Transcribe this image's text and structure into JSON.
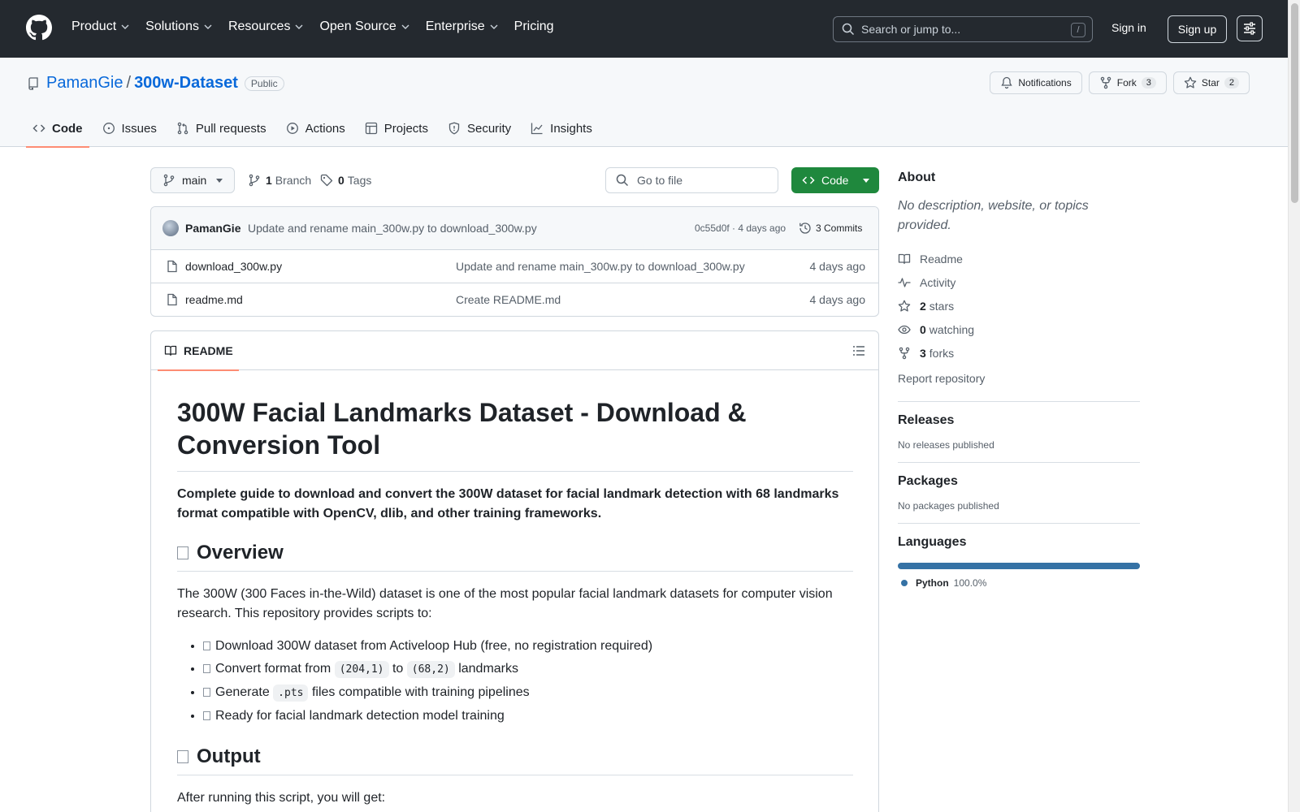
{
  "topbar": {
    "nav": [
      {
        "label": "Product",
        "dropdown": true
      },
      {
        "label": "Solutions",
        "dropdown": true
      },
      {
        "label": "Resources",
        "dropdown": true
      },
      {
        "label": "Open Source",
        "dropdown": true
      },
      {
        "label": "Enterprise",
        "dropdown": true
      },
      {
        "label": "Pricing",
        "dropdown": false
      }
    ],
    "search_placeholder": "Search or jump to...",
    "search_shortcut": "/",
    "signin": "Sign in",
    "signup": "Sign up"
  },
  "repo": {
    "owner": "PamanGie",
    "separator": "/",
    "name": "300w-Dataset",
    "visibility": "Public",
    "notifications_label": "Notifications",
    "fork_label": "Fork",
    "fork_count": "3",
    "star_label": "Star",
    "star_count": "2",
    "tabs": [
      {
        "label": "Code",
        "icon": "code-icon",
        "active": true
      },
      {
        "label": "Issues",
        "icon": "issue-icon",
        "active": false
      },
      {
        "label": "Pull requests",
        "icon": "pull-request-icon",
        "active": false
      },
      {
        "label": "Actions",
        "icon": "play-icon",
        "active": false
      },
      {
        "label": "Projects",
        "icon": "table-icon",
        "active": false
      },
      {
        "label": "Security",
        "icon": "shield-icon",
        "active": false
      },
      {
        "label": "Insights",
        "icon": "graph-icon",
        "active": false
      }
    ]
  },
  "branchbar": {
    "branch": "main",
    "branch_count": "1",
    "branch_label": "Branch",
    "tag_count": "0",
    "tag_label": "Tags",
    "goto_placeholder": "Go to file",
    "code_button": "Code"
  },
  "latest_commit": {
    "author": "PamanGie",
    "message": "Update and rename main_300w.py to download_300w.py",
    "meta": "0c55d0f · 4 days ago",
    "commits": "3 Commits"
  },
  "files": [
    {
      "name": "download_300w.py",
      "commit": "Update and rename main_300w.py to download_300w.py",
      "age": "4 days ago"
    },
    {
      "name": "readme.md",
      "commit": "Create README.md",
      "age": "4 days ago"
    }
  ],
  "readme": {
    "tab_label": "README",
    "title": "300W Facial Landmarks Dataset - Download & Conversion Tool",
    "lead": "Complete guide to download and convert the 300W dataset for facial landmark detection with 68 landmarks format compatible with OpenCV, dlib, and other training frameworks.",
    "overview_heading": "Overview",
    "overview_text": "The 300W (300 Faces in-the-Wild) dataset is one of the most popular facial landmark datasets for computer vision research. This repository provides scripts to:",
    "bullets": {
      "b1": "Download 300W dataset from Activeloop Hub (free, no registration required)",
      "b2_pre": "Convert format from",
      "b2_code1": "(204,1)",
      "b2_mid": "to",
      "b2_code2": "(68,2)",
      "b2_post": "landmarks",
      "b3_pre": "Generate",
      "b3_code": ".pts",
      "b3_post": "files compatible with training pipelines",
      "b4": "Ready for facial landmark detection model training"
    },
    "output_heading": "Output",
    "output_text": "After running this script, you will get:"
  },
  "sidebar": {
    "about_heading": "About",
    "about_desc": "No description, website, or topics provided.",
    "readme_link": "Readme",
    "activity_link": "Activity",
    "stars_count": "2",
    "stars_label": "stars",
    "watching_count": "0",
    "watching_label": "watching",
    "forks_count": "3",
    "forks_label": "forks",
    "report": "Report repository",
    "releases_heading": "Releases",
    "releases_text": "No releases published",
    "packages_heading": "Packages",
    "packages_text": "No packages published",
    "languages_heading": "Languages",
    "language_name": "Python",
    "language_pct": "100.0%",
    "language_fraction": 1.0
  },
  "colors": {
    "header_bg": "#24292f",
    "link": "#0969da",
    "primary_button": "#1f883d",
    "active_tab_underline": "#fd8c73",
    "python": "#3572A5"
  }
}
